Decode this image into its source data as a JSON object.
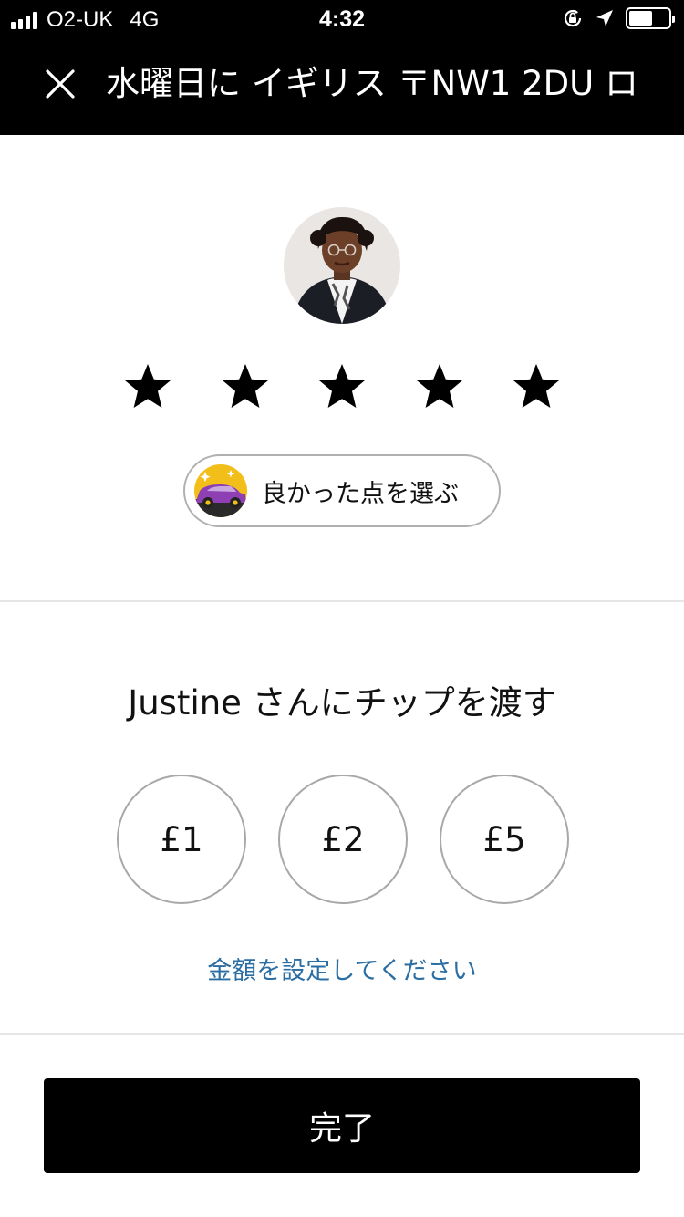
{
  "status_bar": {
    "carrier": "O2-UK",
    "network": "4G",
    "time": "4:32",
    "signal_bars": 4,
    "battery_level": 0.6,
    "icons": [
      "signal-icon",
      "orientation-lock-icon",
      "location-arrow-icon",
      "battery-icon"
    ]
  },
  "header": {
    "title": "水曜日に イギリス 〒NW1 2DU ロ",
    "close_icon": "close-icon"
  },
  "driver": {
    "avatar_icon": "driver-avatar"
  },
  "rating": {
    "max": 5,
    "stars": 5
  },
  "compliment": {
    "label": "良かった点を選ぶ",
    "icon": "car-compliment-icon"
  },
  "tip": {
    "title": "Justine さんにチップを渡す",
    "options": [
      "£1",
      "£2",
      "£5"
    ],
    "custom_label": "金額を設定してください"
  },
  "done": {
    "label": "完了"
  },
  "colors": {
    "bar_bg": "#000000",
    "text_primary": "#000000",
    "link": "#2b6ea3",
    "border": "#a8a8a8",
    "compliment_purple": "#8e3fb3",
    "compliment_gold": "#f2bf1a"
  }
}
